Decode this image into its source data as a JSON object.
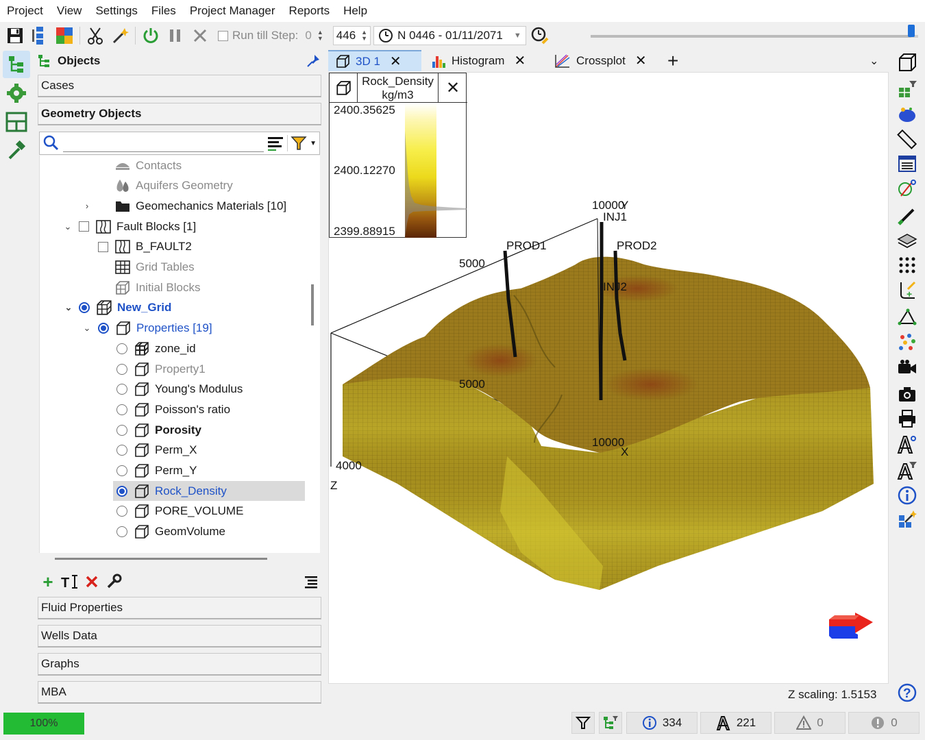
{
  "menu": [
    "Project",
    "View",
    "Settings",
    "Files",
    "Project Manager",
    "Reports",
    "Help"
  ],
  "toolbar": {
    "run_till_label": "Run till Step:",
    "run_till_value": "0",
    "step_value": "446",
    "date_value": "N 0446 - 01/11/2071",
    "timeline_position": 0.98
  },
  "panel": {
    "title": "Objects",
    "sections_top": [
      "Cases",
      "Geometry Objects"
    ],
    "search_placeholder": "",
    "tree": [
      {
        "label": "Contacts",
        "style": "grey",
        "icon": "contacts-icon"
      },
      {
        "label": "Aquifers Geometry",
        "style": "grey",
        "icon": "aquifer-icon"
      },
      {
        "label": "Geomechanics Materials [10]",
        "style": "normal",
        "icon": "folder-icon"
      },
      {
        "label": "Fault Blocks [1]",
        "style": "normal",
        "icon": "fault-icon"
      },
      {
        "label": "B_FAULT2",
        "style": "normal",
        "icon": "fault-icon"
      },
      {
        "label": "Grid Tables",
        "style": "grey",
        "icon": "table-icon"
      },
      {
        "label": "Initial Blocks",
        "style": "grey",
        "icon": "blocks-icon"
      },
      {
        "label": "New_Grid",
        "style": "blue-bold",
        "icon": "grid-icon"
      },
      {
        "label": "Properties [19]",
        "style": "blue",
        "icon": "cube-icon"
      },
      {
        "label": "zone_id",
        "style": "normal",
        "icon": "grid-cube-icon"
      },
      {
        "label": "Property1",
        "style": "grey",
        "icon": "cube-icon"
      },
      {
        "label": "Young's Modulus",
        "style": "normal",
        "icon": "cube-icon"
      },
      {
        "label": "Poisson's ratio",
        "style": "normal",
        "icon": "cube-icon"
      },
      {
        "label": "Porosity",
        "style": "bold",
        "icon": "cube-icon"
      },
      {
        "label": "Perm_X",
        "style": "normal",
        "icon": "cube-icon"
      },
      {
        "label": "Perm_Y",
        "style": "normal",
        "icon": "cube-icon"
      },
      {
        "label": "Rock_Density",
        "style": "selected",
        "icon": "cube-icon"
      },
      {
        "label": "PORE_VOLUME",
        "style": "normal",
        "icon": "cube-icon"
      },
      {
        "label": "GeomVolume",
        "style": "normal",
        "icon": "cube-icon"
      }
    ],
    "sections_bottom": [
      "Fluid Properties",
      "Wells Data",
      "Graphs",
      "MBA"
    ]
  },
  "tabs": [
    {
      "label": "3D 1",
      "icon": "cube-icon",
      "active": true
    },
    {
      "label": "Histogram",
      "icon": "histogram-icon",
      "active": false
    },
    {
      "label": "Crossplot",
      "icon": "crossplot-icon",
      "active": false
    }
  ],
  "legend": {
    "title": "Rock_Density",
    "unit": "kg/m3",
    "max": "2400.35625",
    "mid": "2400.12270",
    "min": "2399.88915"
  },
  "scene": {
    "axis_labels": {
      "y_top": "10000",
      "y_letter": "Y",
      "y_mid": "5000",
      "x_mid": "5000",
      "x_end": "10000",
      "x_letter": "X",
      "z_val": "4000",
      "z_letter": "Z"
    },
    "wells": [
      "PROD1",
      "INJ1",
      "PROD2",
      "INJ2"
    ],
    "colors": {
      "surface": "#9a7a1c",
      "high": "#7a3410",
      "low": "#e9e23a"
    }
  },
  "z_scaling": "Z scaling: 1.5153",
  "status": {
    "progress": "100%",
    "info_count": "334",
    "well_count": "221",
    "warning_count": "0",
    "error_count": "0"
  }
}
